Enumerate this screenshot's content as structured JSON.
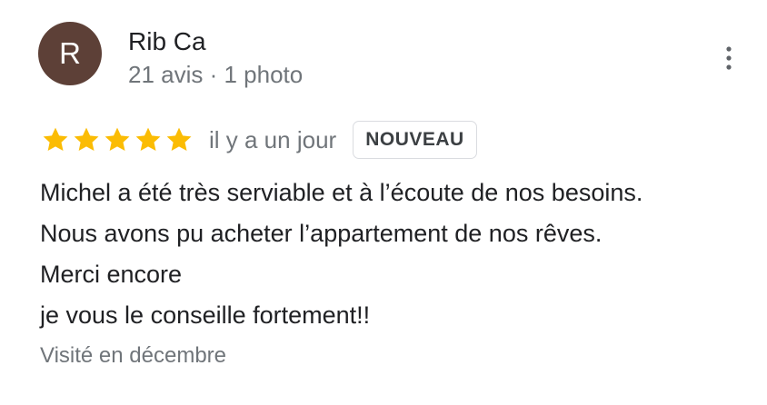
{
  "reviewer": {
    "initial": "R",
    "name": "Rib Ca",
    "meta": "21 avis · 1 photo",
    "avatar_color": "#5d4037"
  },
  "menu": {
    "icon": "more-vert-icon"
  },
  "rating": {
    "stars": 5,
    "max_stars": 5,
    "star_color": "#fbbc04",
    "time": "il y a un jour",
    "badge": "NOUVEAU"
  },
  "review": {
    "lines": [
      "Michel a été très serviable et à l’écoute de nos besoins.",
      "Nous avons pu acheter l’appartement de nos rêves.",
      "Merci encore",
      "je vous le conseille fortement!!"
    ]
  },
  "visited": "Visité en décembre"
}
